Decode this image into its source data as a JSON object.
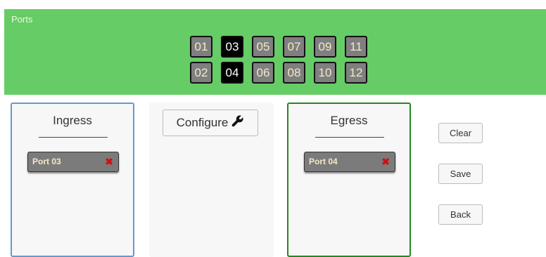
{
  "ports": {
    "title": "Ports",
    "top_row": [
      {
        "label": "01",
        "selected": false
      },
      {
        "label": "03",
        "selected": true
      },
      {
        "label": "05",
        "selected": false
      },
      {
        "label": "07",
        "selected": false
      },
      {
        "label": "09",
        "selected": false
      },
      {
        "label": "11",
        "selected": false
      }
    ],
    "bottom_row": [
      {
        "label": "02",
        "selected": false
      },
      {
        "label": "04",
        "selected": true
      },
      {
        "label": "06",
        "selected": false
      },
      {
        "label": "08",
        "selected": false
      },
      {
        "label": "10",
        "selected": false
      },
      {
        "label": "12",
        "selected": false
      }
    ]
  },
  "ingress": {
    "title": "Ingress",
    "items": [
      {
        "label": "Port 03",
        "remove_glyph": "✖"
      }
    ]
  },
  "configure": {
    "label": "Configure",
    "icon": "wrench-icon"
  },
  "egress": {
    "title": "Egress",
    "items": [
      {
        "label": "Port 04",
        "remove_glyph": "✖"
      }
    ]
  },
  "actions": {
    "clear_label": "Clear",
    "save_label": "Save",
    "back_label": "Back"
  },
  "colors": {
    "panel_bg": "#66cc66",
    "port_bg": "#7f7f7f",
    "port_selected_bg": "#000000",
    "ingress_border": "#6699cc",
    "egress_border": "#228822",
    "remove_red": "#cc1111"
  }
}
